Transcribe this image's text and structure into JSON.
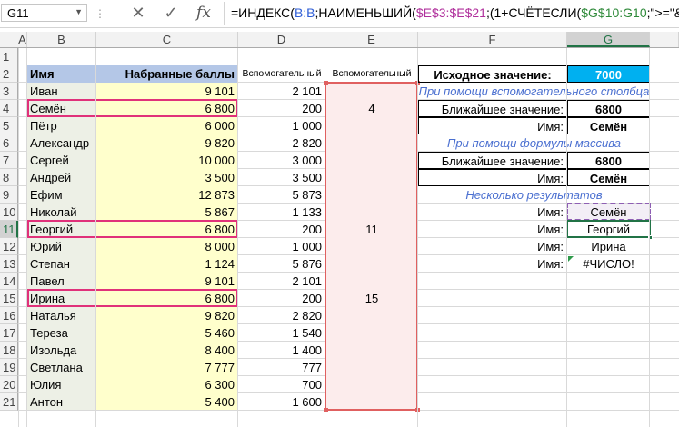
{
  "formula_bar": {
    "name_box": "G11",
    "formula_parts": [
      {
        "t": "=ИНДЕКС(",
        "c": ""
      },
      {
        "t": "B:B",
        "c": "fb"
      },
      {
        "t": ";НАИМЕНЬШИЙ(",
        "c": ""
      },
      {
        "t": "$E$3:$E$21",
        "c": "fp"
      },
      {
        "t": ";(1+СЧЁТЕСЛИ(",
        "c": ""
      },
      {
        "t": "$G$10:G10",
        "c": "fg"
      },
      {
        "t": ";\">=\"&\" \"))))",
        "c": ""
      }
    ]
  },
  "columns": [
    "A",
    "B",
    "C",
    "D",
    "E",
    "F",
    "G"
  ],
  "selected_column": "G",
  "rows": [
    "1",
    "2",
    "3",
    "4",
    "5",
    "6",
    "7",
    "8",
    "9",
    "10",
    "11",
    "12",
    "13",
    "14",
    "15",
    "16",
    "17",
    "18",
    "19",
    "20",
    "21"
  ],
  "selected_row": "11",
  "headers": {
    "name": "Имя",
    "score": "Набранные баллы",
    "helper_d": "Вспомогательный",
    "helper_e": "Вспомогательный"
  },
  "table": [
    {
      "name": "Иван",
      "score": "9 101",
      "d": "2 101",
      "e": ""
    },
    {
      "name": "Семён",
      "score": "6 800",
      "d": "200",
      "e": "4"
    },
    {
      "name": "Пётр",
      "score": "6 000",
      "d": "1 000",
      "e": ""
    },
    {
      "name": "Александр",
      "score": "9 820",
      "d": "2 820",
      "e": ""
    },
    {
      "name": "Сергей",
      "score": "10 000",
      "d": "3 000",
      "e": ""
    },
    {
      "name": "Андрей",
      "score": "3 500",
      "d": "3 500",
      "e": ""
    },
    {
      "name": "Ефим",
      "score": "12 873",
      "d": "5 873",
      "e": ""
    },
    {
      "name": "Николай",
      "score": "5 867",
      "d": "1 133",
      "e": ""
    },
    {
      "name": "Георгий",
      "score": "6 800",
      "d": "200",
      "e": "11"
    },
    {
      "name": "Юрий",
      "score": "8 000",
      "d": "1 000",
      "e": ""
    },
    {
      "name": "Степан",
      "score": "1 124",
      "d": "5 876",
      "e": ""
    },
    {
      "name": "Павел",
      "score": "9 101",
      "d": "2 101",
      "e": ""
    },
    {
      "name": "Ирина",
      "score": "6 800",
      "d": "200",
      "e": "15"
    },
    {
      "name": "Наталья",
      "score": "9 820",
      "d": "2 820",
      "e": ""
    },
    {
      "name": "Тереза",
      "score": "5 460",
      "d": "1 540",
      "e": ""
    },
    {
      "name": "Изольда",
      "score": "8 400",
      "d": "1 400",
      "e": ""
    },
    {
      "name": "Светлана",
      "score": "7 777",
      "d": "777",
      "e": ""
    },
    {
      "name": "Юлия",
      "score": "6 300",
      "d": "700",
      "e": ""
    },
    {
      "name": "Антон",
      "score": "5 400",
      "d": "1 600",
      "e": ""
    }
  ],
  "panel": {
    "source_label": "Исходное значение:",
    "source_value": "7000",
    "section1": "При помощи вспомогательного столбца",
    "closest_label": "Ближайшее значение:",
    "closest1": "6800",
    "name_label": "Имя:",
    "name1": "Семён",
    "section2": "При помощи формулы массива",
    "closest2": "6800",
    "name2": "Семён",
    "section3": "Несколько результатов",
    "results": [
      {
        "label": "Имя:",
        "value": "Семён"
      },
      {
        "label": "Имя:",
        "value": "Георгий"
      },
      {
        "label": "Имя:",
        "value": "Ирина"
      },
      {
        "label": "Имя:",
        "value": "#ЧИСЛО!"
      }
    ]
  },
  "colors": {
    "header_fill": "#b4c7e7",
    "score_fill": "#ffffcc",
    "name_fill": "#edf0e6",
    "helper_fill": "#fcecec",
    "source_fill": "#00b0f0",
    "highlight_border": "#e0317a",
    "selection_green": "#217346"
  }
}
